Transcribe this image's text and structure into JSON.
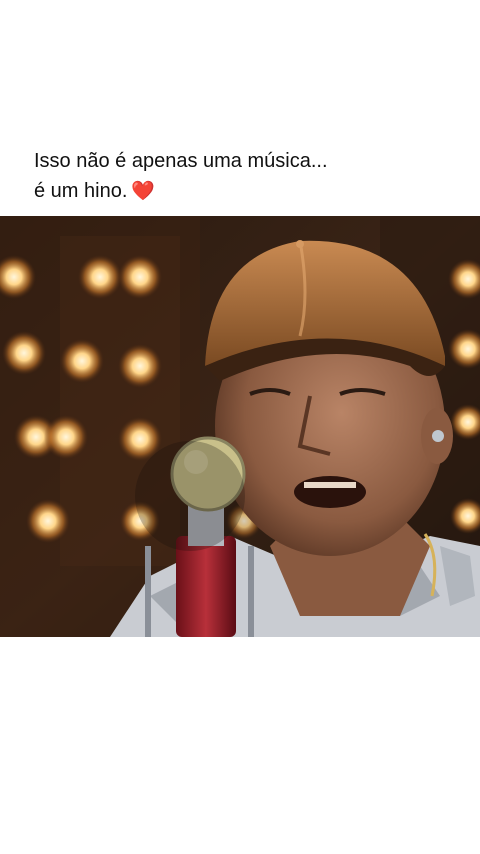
{
  "post": {
    "caption_line1": "Isso não é apenas uma música...",
    "caption_line2": "é um hino.",
    "caption_emoji": "❤️"
  },
  "video": {
    "description_icon": "video-frame-singer-microphone"
  },
  "colors": {
    "background": "#ffffff",
    "text": "#111111",
    "heart": "#d8112c"
  }
}
